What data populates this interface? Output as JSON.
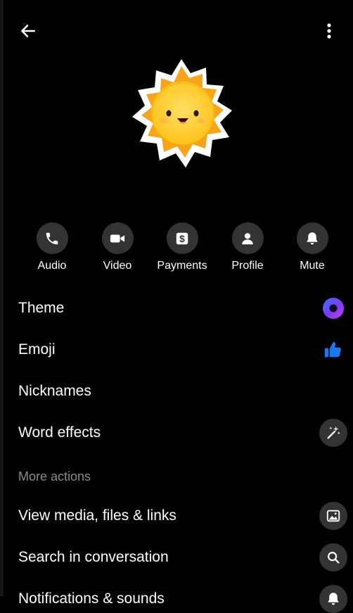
{
  "header": {
    "back_icon": "arrow-left-icon",
    "more_icon": "vertical-dots-icon"
  },
  "avatar": {
    "icon": "smiling-sun-sticker"
  },
  "actions": [
    {
      "label": "Audio",
      "icon": "phone-icon"
    },
    {
      "label": "Video",
      "icon": "video-camera-icon"
    },
    {
      "label": "Payments",
      "icon": "dollar-icon"
    },
    {
      "label": "Profile",
      "icon": "person-icon"
    },
    {
      "label": "Mute",
      "icon": "bell-icon"
    }
  ],
  "settings": {
    "theme": {
      "label": "Theme",
      "icon": "theme-color-dot-icon",
      "color": "#6b3cf2"
    },
    "emoji": {
      "label": "Emoji",
      "icon": "thumbs-up-icon",
      "color": "#1877f2"
    },
    "nicknames": {
      "label": "Nicknames"
    },
    "word_effects": {
      "label": "Word effects",
      "icon": "magic-wand-icon"
    }
  },
  "more_actions": {
    "header": "More actions",
    "items": [
      {
        "label": "View media, files & links",
        "icon": "image-icon"
      },
      {
        "label": "Search in conversation",
        "icon": "search-icon"
      },
      {
        "label": "Notifications & sounds",
        "icon": "bell-icon"
      }
    ]
  }
}
